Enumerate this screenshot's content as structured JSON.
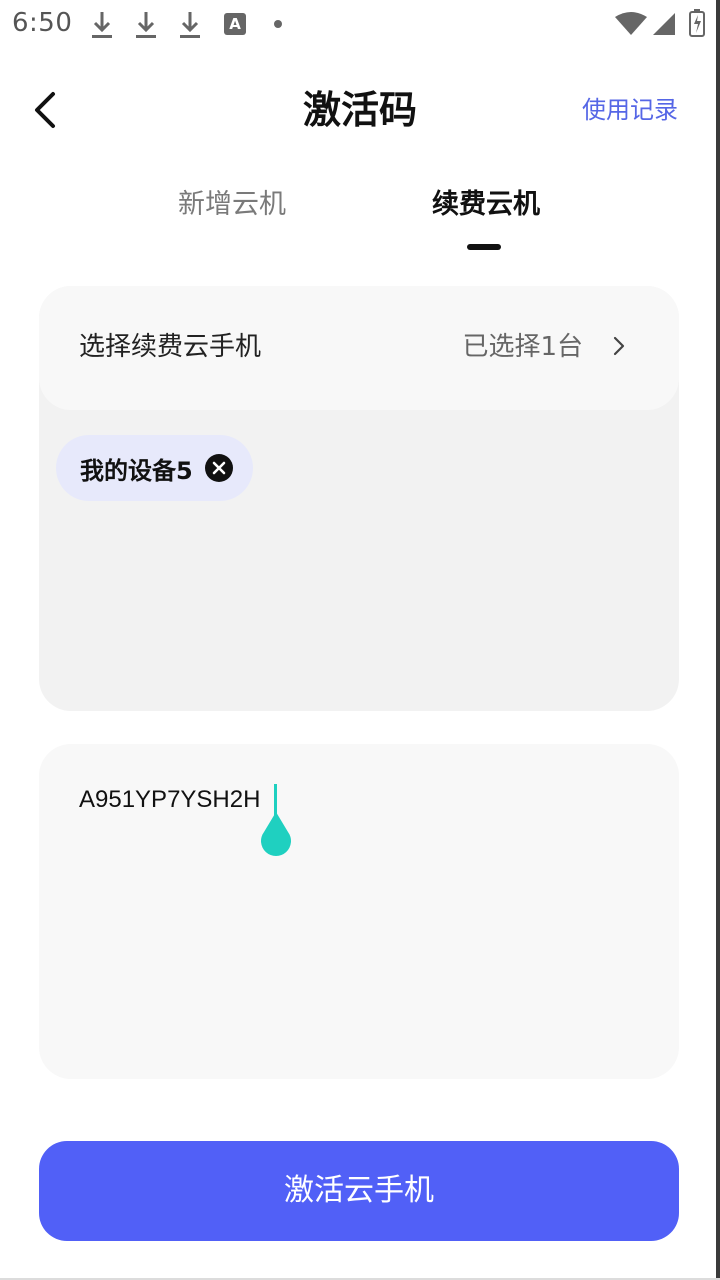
{
  "status_bar": {
    "time": "6:50",
    "a_icon_text": "A",
    "icons": [
      "download-icon",
      "download-icon",
      "download-icon",
      "a-icon",
      "dot-icon",
      "wifi-icon",
      "signal-icon",
      "battery-icon"
    ]
  },
  "header": {
    "title": "激活码",
    "right_link": "使用记录",
    "back_icon": "chevron-left-icon"
  },
  "tabs": [
    {
      "label": "新增云机",
      "active": false
    },
    {
      "label": "续费云机",
      "active": true
    }
  ],
  "select_card": {
    "label": "选择续费云手机",
    "count_text": "已选择1台",
    "chip_label": "我的设备5"
  },
  "code_input": {
    "value": "A951YP7YSH2H"
  },
  "activate_button": {
    "label": "激活云手机"
  },
  "colors": {
    "accent": "#5160f7",
    "link": "#5566e6",
    "chip_bg": "#e7e9fb",
    "caret": "#1fd0c0"
  }
}
